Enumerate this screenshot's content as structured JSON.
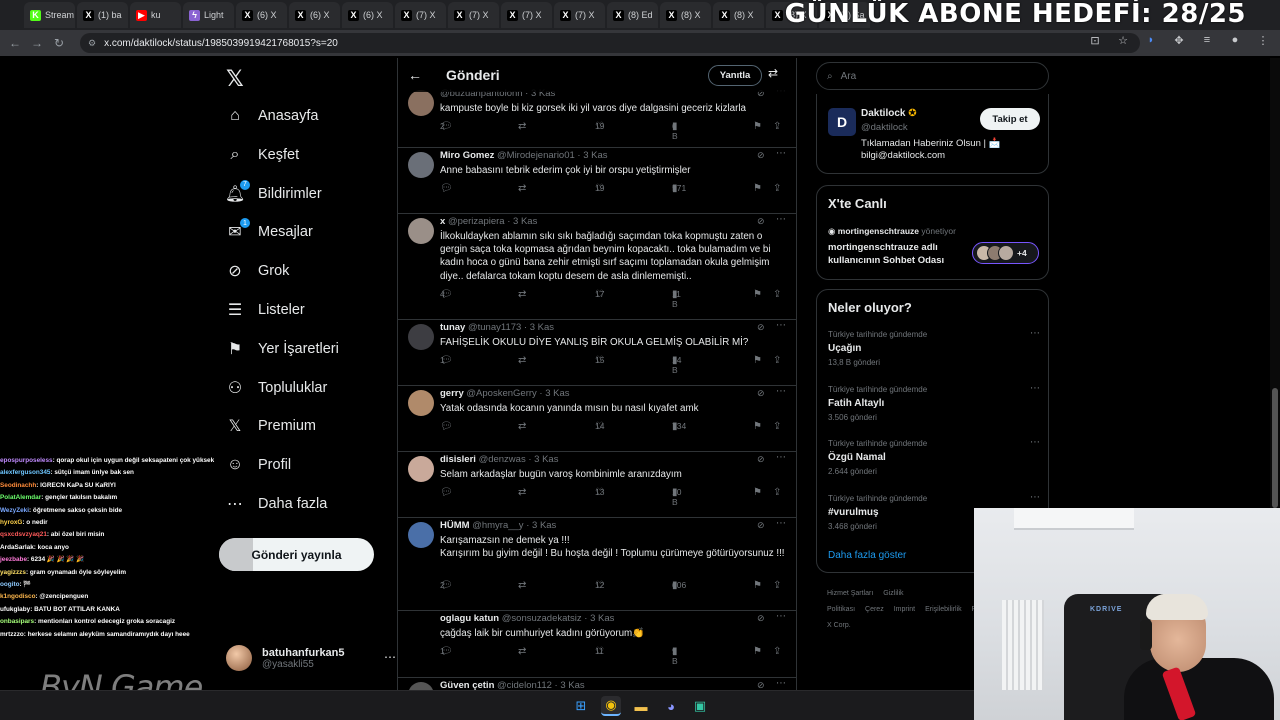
{
  "browser": {
    "tabs": [
      {
        "label": "Stream",
        "icon": "kick-icon",
        "color": "#53fc18"
      },
      {
        "label": "(1) ba",
        "icon": "x-icon",
        "color": "#000000"
      },
      {
        "label": "ku",
        "icon": "youtube-icon",
        "color": "#ff0000"
      },
      {
        "label": "Light",
        "icon": "lightning-icon",
        "color": "#8a63d2"
      },
      {
        "label": "(6) X",
        "icon": "x-icon",
        "color": "#000000"
      },
      {
        "label": "(6) X",
        "icon": "x-icon",
        "color": "#000000"
      },
      {
        "label": "(6) X",
        "icon": "x-icon",
        "color": "#000000"
      },
      {
        "label": "(7) X",
        "icon": "x-icon",
        "color": "#000000"
      },
      {
        "label": "(7) X",
        "icon": "x-icon",
        "color": "#000000"
      },
      {
        "label": "(7) X",
        "icon": "x-icon",
        "color": "#000000"
      },
      {
        "label": "(7) X",
        "icon": "x-icon",
        "color": "#000000"
      },
      {
        "label": "(8) Ed",
        "icon": "x-icon",
        "color": "#000000"
      },
      {
        "label": "(8) X",
        "icon": "x-icon",
        "color": "#000000"
      },
      {
        "label": "(8) X",
        "icon": "x-icon",
        "color": "#000000"
      },
      {
        "label": "(8) X",
        "icon": "x-icon",
        "color": "#000000"
      },
      {
        "label": "(8) Sa",
        "icon": "x-icon",
        "color": "#000000"
      }
    ],
    "url": "x.com/daktilock/status/1985039919421768015?s=20"
  },
  "overlay": {
    "title": "GÜNLÜK ABONE HEDEFİ: 28/25"
  },
  "nav": {
    "items": [
      {
        "label": "Anasayfa",
        "icon": "home-icon",
        "glyph": "⌂"
      },
      {
        "label": "Keşfet",
        "icon": "search-icon",
        "glyph": "⌕"
      },
      {
        "label": "Bildirimler",
        "icon": "bell-icon",
        "glyph": "🔔︎",
        "badge": "7"
      },
      {
        "label": "Mesajlar",
        "icon": "mail-icon",
        "glyph": "✉",
        "badge": "1"
      },
      {
        "label": "Grok",
        "icon": "grok-icon",
        "glyph": "⊘"
      },
      {
        "label": "Listeler",
        "icon": "list-icon",
        "glyph": "☰"
      },
      {
        "label": "Yer İşaretleri",
        "icon": "bookmark-icon",
        "glyph": "⚑"
      },
      {
        "label": "Topluluklar",
        "icon": "community-icon",
        "glyph": "⚇"
      },
      {
        "label": "Premium",
        "icon": "x-premium-icon",
        "glyph": "𝕏"
      },
      {
        "label": "Profil",
        "icon": "profile-icon",
        "glyph": "☺"
      },
      {
        "label": "Daha fazla",
        "icon": "more-circle-icon",
        "glyph": "⋯"
      }
    ],
    "post_button": "Gönderi yayınla",
    "user": {
      "name": "batuhanfurkan5",
      "handle": "@yasakli55"
    }
  },
  "chat": {
    "lines": [
      {
        "user": "epospurposeless",
        "color": "#c08bff",
        "text": ": qorap okul için uygun değil seksapateni çok yüksek"
      },
      {
        "user": "alexferguson345",
        "color": "#6ec6ff",
        "text": ": sütçü imam ünlye bak sen"
      },
      {
        "user": "Seodinachh",
        "color": "#ff8c3a",
        "text": ": IGRECN KaPa SU KaRIYI"
      },
      {
        "user": "PolatAlemdar",
        "color": "#6cff6c",
        "text": ": gençler takılsın bakalım"
      },
      {
        "user": "WezyZeki",
        "color": "#7aa8ff",
        "text": ": öğretmene sakso çeksin bide"
      },
      {
        "user": "hyroxG",
        "color": "#ffd24a",
        "text": ": o nedir"
      },
      {
        "user": "qsxcdsvzyaq21",
        "color": "#ff5a5a",
        "text": ": abi özel biri misin"
      },
      {
        "user": "ArdaSarlak",
        "color": "#ffffff",
        "text": ": koca anyo"
      },
      {
        "user": "jeezbabe",
        "color": "#ff7ad9",
        "text": ": 6234 🎉 🎉 🎉 🎉"
      },
      {
        "user": "yagizzzs",
        "color": "#ffe066",
        "text": ": gram oynamadı öyle söyleyelim"
      },
      {
        "user": "oogito",
        "color": "#8ecbff",
        "text": ": 🏁"
      },
      {
        "user": "k1ngodisco",
        "color": "#ffb84d",
        "text": ": @zencipenguen"
      },
      {
        "user": "ufukglaby",
        "color": "#ffffff",
        "text": ": BATU BOT ATTILAR KANKA"
      },
      {
        "user": "onbasipars",
        "color": "#a6ff7a",
        "text": ": mentionları kontrol edecegiz groka soracagiz"
      },
      {
        "user": "mrtzzzo",
        "color": "#ffffff",
        "text": ": herkese selamın aleyküm samandiramıydık dayı heee"
      }
    ],
    "watermark": "ByN Game"
  },
  "main": {
    "title": "Gönderi",
    "reply_button": "Yanıtla",
    "posts": [
      {
        "name": "",
        "handle": "@buzuanpantolonn",
        "time": "3 Kas",
        "text": "kampuste boyle bi kiz gorsek iki yil varos diye dalgasini geceriz kizlarla",
        "replies": "2",
        "likes": "19",
        "views": "6 B",
        "avatar_color": "#8a7060"
      },
      {
        "name": "Miro Gomez",
        "handle": "@Mirodejenario01",
        "time": "3 Kas",
        "text": "Anne babasını tebrik ederim çok iyi bir orspu yetiştirmişler",
        "replies": "",
        "likes": "19",
        "views": "571",
        "avatar_color": "#6a6f78"
      },
      {
        "name": "x",
        "handle": "@perizapiera",
        "time": "3 Kas",
        "text": "İlkokuldayken ablamın sıkı sıkı bağladığı saçımdan toka kopmuştu zaten o gergin saça toka kopmasa ağrıdan beynim kopacaktı.. toka bulamadım ve bi kadın hoca o günü bana zehir etmişti sırf saçımı toplamadan okula gelmişim diye.. defalarca tokam koptu desem de asla dinlememişti..",
        "replies": "4",
        "likes": "17",
        "views": "11 B",
        "avatar_color": "#9a8f88"
      },
      {
        "name": "tunay",
        "handle": "@tunay1173",
        "time": "3 Kas",
        "text": "FAHİŞELİK OKULU DİYE YANLIŞ BİR OKULA GELMİŞ OLABİLİR Mİ?",
        "replies": "1",
        "likes": "15",
        "views": "14 B",
        "avatar_color": "#3d3d42"
      },
      {
        "name": "gerry",
        "handle": "@AposkenGerry",
        "time": "3 Kas",
        "text": "Yatak odasında kocanın yanında mısın bu nasıl kıyafet amk",
        "replies": "",
        "likes": "14",
        "views": "734",
        "avatar_color": "#b08a6a"
      },
      {
        "name": "disisleri",
        "handle": "@denzwas",
        "time": "3 Kas",
        "text": "Selam arkadaşlar bugün varoş kombinimle aranızdayım",
        "replies": "",
        "likes": "13",
        "views": "10 B",
        "avatar_color": "#c9a99a"
      },
      {
        "name": "HÜMM",
        "handle": "@hmyra__y",
        "time": "3 Kas",
        "text": "Karışamazsın ne demek ya !!!\nKarışırım bu giyim değil ! Bu hoşta değil ! Toplumu çürümeye götürüyorsunuz !!!",
        "replies": "2",
        "likes": "12",
        "views": "606",
        "avatar_color": "#4a6fa8"
      },
      {
        "name": "oglagu katun",
        "handle": "@sonsuzadekatsiz",
        "time": "3 Kas",
        "text": "çağdaş laik bir cumhuriyet kadını görüyorum👏",
        "replies": "1",
        "likes": "11",
        "views": "9 B",
        "avatar_color": "#000000"
      },
      {
        "name": "Güven çetin",
        "handle": "@cidelon112",
        "time": "3 Kas",
        "text": "",
        "replies": "",
        "likes": "",
        "views": "",
        "avatar_color": "#555555"
      }
    ]
  },
  "right": {
    "search_placeholder": "Ara",
    "account": {
      "name": "Daktilock",
      "handle": "@daktilock",
      "bio": "Tıklamadan Haberiniz Olsun | 📩 bilgi@daktilock.com",
      "follow": "Takip et",
      "logo": "D"
    },
    "live": {
      "title": "X'te Canlı",
      "host": "mortingenschtrauze",
      "host_suffix": "yönetiyor",
      "space_title": "mortingenschtrauze adlı kullanıcının Sohbet Odası",
      "extra": "+4"
    },
    "trends": {
      "title": "Neler oluyor?",
      "items": [
        {
          "category": "Türkiye tarihinde gündemde",
          "title": "Uçağın",
          "count": "13,8 B gönderi"
        },
        {
          "category": "Türkiye tarihinde gündemde",
          "title": "Fatih Altaylı",
          "count": "3.506 gönderi"
        },
        {
          "category": "Türkiye tarihinde gündemde",
          "title": "Özgü Namal",
          "count": "2.644 gönderi"
        },
        {
          "category": "Türkiye tarihinde gündemde",
          "title": "#vurulmuş",
          "count": "3.468 gönderi"
        }
      ],
      "show_more": "Daha fazla göster"
    },
    "footer": [
      "Hizmet Şartları",
      "Gizlilik Politikası",
      "Çerez",
      "Imprint",
      "Erişilebilirlik",
      "Reklam bilgisi",
      "© 2025 X Corp."
    ]
  },
  "webcam": {
    "chair_brand": "KDRIVE"
  }
}
